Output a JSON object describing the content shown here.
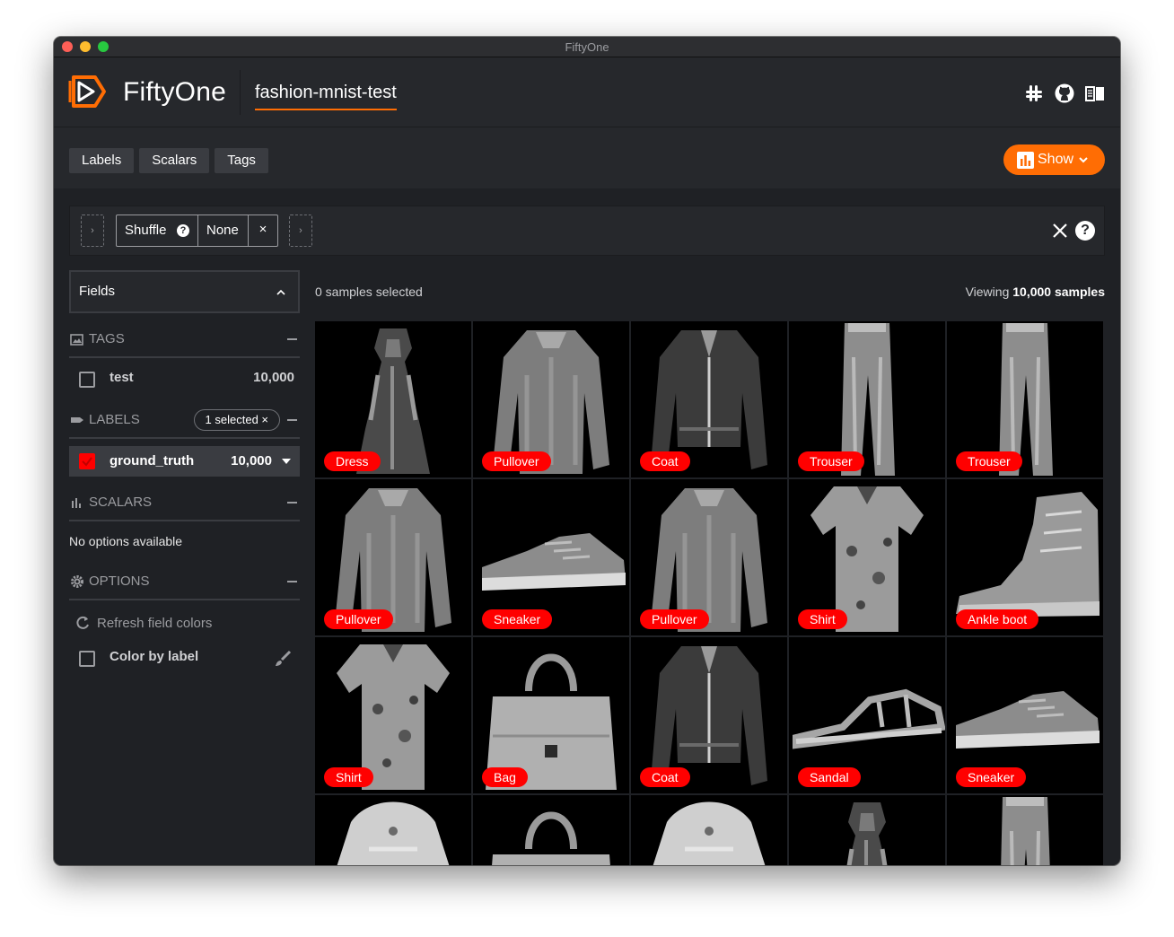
{
  "window": {
    "title": "FiftyOne"
  },
  "header": {
    "logo_text": "FiftyOne",
    "dataset_name": "fashion-mnist-test",
    "icons": [
      "slack-icon",
      "github-icon",
      "docs-book-icon"
    ]
  },
  "toolbar": {
    "tabs": [
      "Labels",
      "Scalars",
      "Tags"
    ],
    "show_button": "Show"
  },
  "view_bar": {
    "stage_name": "Shuffle",
    "stage_value": "None",
    "stage_remove": "×",
    "add_stage": "›"
  },
  "sidebar": {
    "fields_label": "Fields",
    "tags": {
      "title": "TAGS",
      "items": [
        {
          "label": "test",
          "count": "10,000",
          "checked": false
        }
      ]
    },
    "labels": {
      "title": "LABELS",
      "selected_pill": "1 selected ×",
      "items": [
        {
          "label": "ground_truth",
          "count": "10,000",
          "checked": true,
          "color": "#ff0000"
        }
      ]
    },
    "scalars": {
      "title": "SCALARS",
      "empty": "No options available"
    },
    "options": {
      "title": "OPTIONS",
      "refresh": "Refresh field colors",
      "color_by_label": "Color by label"
    }
  },
  "main": {
    "samples_selected": "0 samples selected",
    "viewing_prefix": "Viewing",
    "viewing_count": "10,000 samples",
    "samples": [
      {
        "label": "Dress",
        "kind": "dress"
      },
      {
        "label": "Pullover",
        "kind": "pullover"
      },
      {
        "label": "Coat",
        "kind": "coat"
      },
      {
        "label": "Trouser",
        "kind": "trouser"
      },
      {
        "label": "Trouser",
        "kind": "trouser"
      },
      {
        "label": "Pullover",
        "kind": "pullover"
      },
      {
        "label": "Sneaker",
        "kind": "sneaker"
      },
      {
        "label": "Pullover",
        "kind": "pullover"
      },
      {
        "label": "Shirt",
        "kind": "shirt"
      },
      {
        "label": "Ankle boot",
        "kind": "boot"
      },
      {
        "label": "Shirt",
        "kind": "shirt"
      },
      {
        "label": "Bag",
        "kind": "bag"
      },
      {
        "label": "Coat",
        "kind": "coat"
      },
      {
        "label": "Sandal",
        "kind": "sandal"
      },
      {
        "label": "Sneaker",
        "kind": "sneaker"
      },
      {
        "label": "",
        "kind": "top"
      },
      {
        "label": "",
        "kind": "bag"
      },
      {
        "label": "",
        "kind": "top"
      },
      {
        "label": "",
        "kind": "dress"
      },
      {
        "label": "",
        "kind": "trouser"
      }
    ]
  },
  "colors": {
    "accent": "#ff6d04",
    "label_tag": "#ff0000",
    "background": "#1f2125",
    "panel": "#26282c"
  }
}
